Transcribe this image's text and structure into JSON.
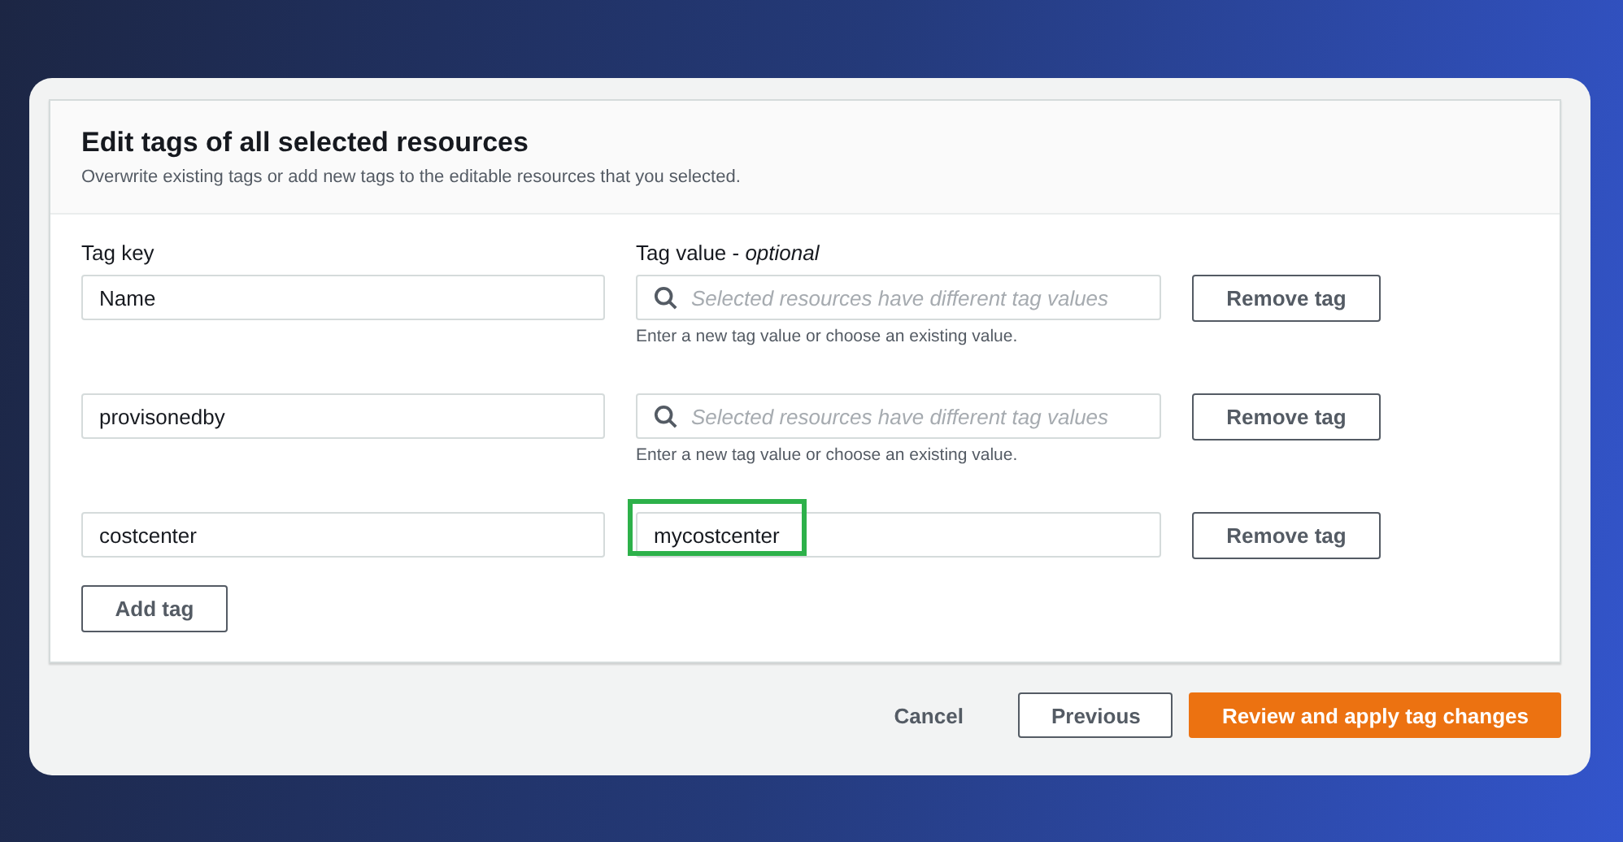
{
  "header": {
    "title": "Edit tags of all selected resources",
    "description": "Overwrite existing tags or add new tags to the editable resources that you selected."
  },
  "columns": {
    "key_label": "Tag key",
    "value_label": "Tag value - *optional*"
  },
  "tags": [
    {
      "key": "Name",
      "kind": "search",
      "placeholder": "Selected resources have different tag values",
      "hint": "Enter a new tag value or choose an existing value.",
      "highlighted": false,
      "remove_label": "Remove tag"
    },
    {
      "key": "provisonedby",
      "kind": "search",
      "placeholder": "Selected resources have different tag values",
      "hint": "Enter a new tag value or choose an existing value.",
      "highlighted": false,
      "remove_label": "Remove tag"
    },
    {
      "key": "costcenter",
      "kind": "text",
      "value": "mycostcenter",
      "highlighted": true,
      "remove_label": "Remove tag"
    }
  ],
  "add_label": "Add tag",
  "footer": {
    "cancel": "Cancel",
    "previous": "Previous",
    "submit": "Review and apply tag changes"
  }
}
